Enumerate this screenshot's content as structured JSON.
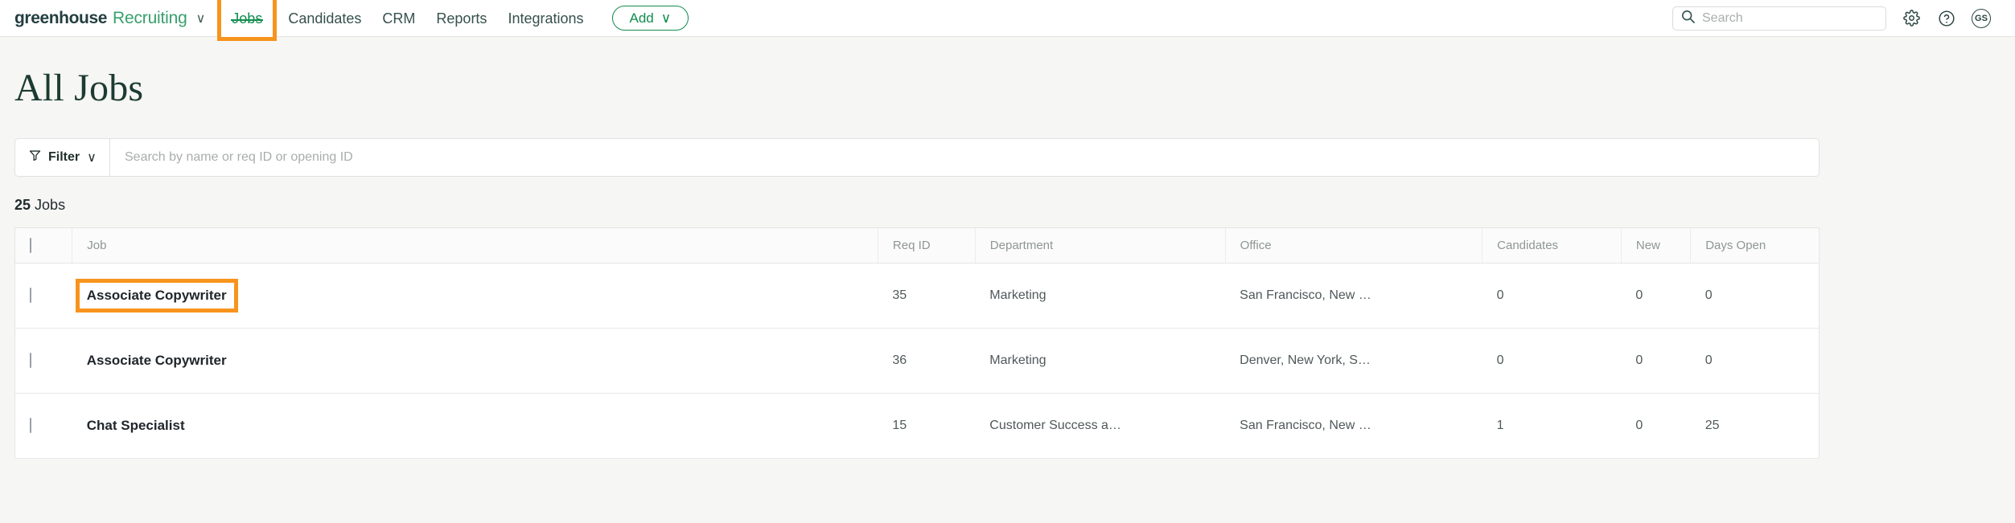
{
  "topnav": {
    "brand_word": "greenhouse",
    "brand_product": "Recruiting",
    "brand_caret": "∨",
    "links": [
      {
        "label": "Jobs",
        "active": true
      },
      {
        "label": "Candidates",
        "active": false
      },
      {
        "label": "CRM",
        "active": false
      },
      {
        "label": "Reports",
        "active": false
      },
      {
        "label": "Integrations",
        "active": false
      }
    ],
    "add_label": "Add",
    "add_caret": "∨",
    "search_placeholder": "Search",
    "avatar_initials": "GS"
  },
  "page": {
    "title": "All Jobs"
  },
  "filterbar": {
    "filter_label": "Filter",
    "filter_caret": "∨",
    "search_placeholder": "Search by name or req ID or opening ID"
  },
  "count": {
    "number": "25",
    "word": "Jobs"
  },
  "table": {
    "headers": {
      "job": "Job",
      "req_id": "Req ID",
      "department": "Department",
      "office": "Office",
      "candidates": "Candidates",
      "new": "New",
      "days_open": "Days Open"
    },
    "rows": [
      {
        "job": "Associate Copywriter",
        "highlighted": true,
        "req_id": "35",
        "department": "Marketing",
        "office": "San Francisco, New …",
        "candidates": "0",
        "new": "0",
        "days_open": "0"
      },
      {
        "job": "Associate Copywriter",
        "highlighted": false,
        "req_id": "36",
        "department": "Marketing",
        "office": "Denver, New York, S…",
        "candidates": "0",
        "new": "0",
        "days_open": "0"
      },
      {
        "job": "Chat Specialist",
        "highlighted": false,
        "req_id": "15",
        "department": "Customer Success a…",
        "office": "San Francisco, New …",
        "candidates": "1",
        "new": "0",
        "days_open": "25"
      }
    ]
  },
  "colors": {
    "brand_green": "#38a06c",
    "active_green": "#118c4f",
    "highlight_orange": "#f7941e",
    "title_green": "#1c3b32",
    "page_bg": "#f6f6f5"
  }
}
